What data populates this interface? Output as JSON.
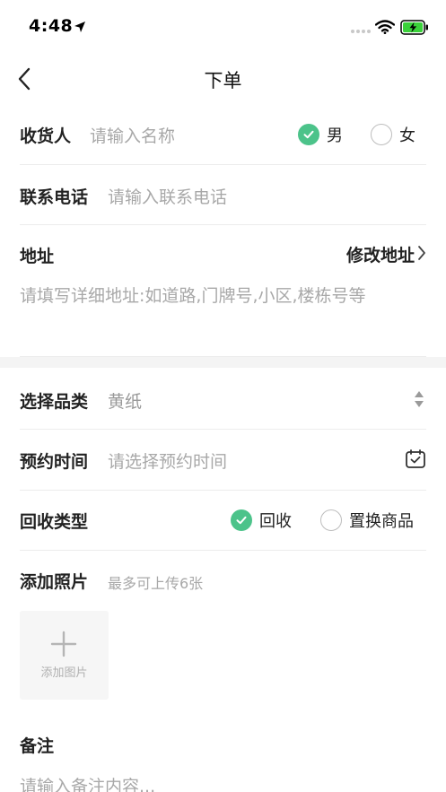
{
  "status": {
    "time": "4:48"
  },
  "nav": {
    "title": "下单"
  },
  "receiver": {
    "label": "收货人",
    "placeholder": "请输入名称",
    "options": [
      {
        "label": "男",
        "checked": true
      },
      {
        "label": "女",
        "checked": false
      }
    ]
  },
  "phone": {
    "label": "联系电话",
    "placeholder": "请输入联系电话"
  },
  "address": {
    "label": "地址",
    "modify_label": "修改地址",
    "placeholder": "请填写详细地址:如道路,门牌号,小区,楼栋号等"
  },
  "category": {
    "label": "选择品类",
    "value": "黄纸"
  },
  "appointment": {
    "label": "预约时间",
    "placeholder": "请选择预约时间"
  },
  "recycle_type": {
    "label": "回收类型",
    "options": [
      {
        "label": "回收",
        "checked": true
      },
      {
        "label": "置换商品",
        "checked": false
      }
    ]
  },
  "photos": {
    "label": "添加照片",
    "hint": "最多可上传6张",
    "add_label": "添加图片"
  },
  "remark": {
    "label": "备注",
    "placeholder": "请输入备注内容..."
  },
  "colors": {
    "accent": "#4cc38a",
    "placeholder": "#a8a8a8",
    "divider": "#ececec"
  }
}
